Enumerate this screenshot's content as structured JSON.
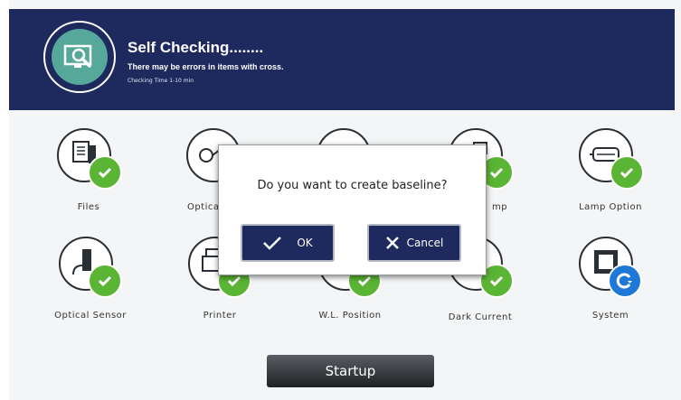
{
  "header": {
    "title": "Self Checking........",
    "subtitle": "There may be errors in items with cross.",
    "time": "Checking Time 1-10 min",
    "logo_icon": "monitor-search-icon"
  },
  "items": [
    {
      "label": "Files",
      "icon": "files-icon",
      "status": "ok"
    },
    {
      "label": "Optica",
      "icon": "optical-system-icon",
      "status": "ok"
    },
    {
      "label": "",
      "icon": "lamp-icon",
      "status": "ok"
    },
    {
      "label": "mp",
      "icon": "lamp-icon",
      "status": "ok"
    },
    {
      "label": "Lamp Option",
      "icon": "lamp-option-icon",
      "status": "ok"
    },
    {
      "label": "Optical Sensor",
      "icon": "optical-sensor-icon",
      "status": "ok"
    },
    {
      "label": "Printer",
      "icon": "printer-icon",
      "status": "ok"
    },
    {
      "label": "W.L. Position",
      "icon": "wavelength-icon",
      "status": "ok"
    },
    {
      "label": "Dark Current",
      "icon": "dark-current-icon",
      "status": "ok"
    },
    {
      "label": "System",
      "icon": "chip-icon",
      "status": "checking"
    }
  ],
  "dialog": {
    "message": "Do you want to create baseline?",
    "ok_label": "OK",
    "cancel_label": "Cancel"
  },
  "startup_label": "Startup",
  "colors": {
    "header_bg": "#1e2a5e",
    "ok_green": "#5bb534",
    "checking_blue": "#1e78d8",
    "button_navy": "#1e2a5e"
  }
}
